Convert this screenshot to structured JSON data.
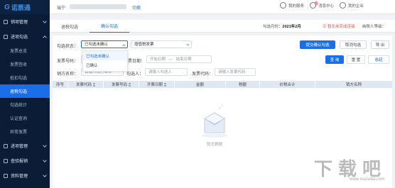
{
  "app": {
    "logo_mark": "G",
    "logo_text": "诺票通"
  },
  "sidebar": {
    "groups": [
      {
        "label": "销项管理"
      },
      {
        "label": "进项勾选"
      },
      {
        "label": "进项管理"
      },
      {
        "label": "查验报销"
      },
      {
        "label": "资料管理"
      }
    ],
    "items": [
      {
        "label": "发票总览"
      },
      {
        "label": "发票签收"
      },
      {
        "label": "抵扣勾选"
      },
      {
        "label": "退税勾选"
      },
      {
        "label": "勾选统计"
      },
      {
        "label": "认证查询"
      },
      {
        "label": "异常发票"
      }
    ]
  },
  "header": {
    "company_prefix": "瑞宁",
    "switch_label": "切换",
    "my_service": "我的服务",
    "messages": "消息中心",
    "messages_badge": "9",
    "my_company": "我的企业"
  },
  "tabs": {
    "items": [
      {
        "label": "退税勾选"
      },
      {
        "label": "确认勾选"
      }
    ],
    "period_label": "勾选月份：",
    "period_value": "2021年2月",
    "status_note": "⊘ 暂无未完成连接",
    "taxpayer_label": "纳税人等级："
  },
  "filters": {
    "status_label": "勾选状态：",
    "status_value": "已勾选未确认",
    "type_value": "增值税发票",
    "invoice_code_label": "发票号码：",
    "invoice_code_placeholder": "",
    "date_label": "开票日期：",
    "date_start_placeholder": "开始日期",
    "date_sep": "—",
    "date_end_placeholder": "结束日期",
    "seller_label": "销方名称：",
    "seller_placeholder": "请输入销方名称",
    "checker_label": "勾选人：",
    "checker_placeholder": "请输入勾选人",
    "invoice_code2_label": "发票代码：",
    "invoice_code2_placeholder": "请输入发票代码",
    "dropdown_options": [
      "已勾选未确认",
      "已确认"
    ]
  },
  "actions": {
    "submit": "提交确认勾选",
    "cancel": "取消勾选",
    "export": "导 出",
    "search": "查 询",
    "reset": "重 置",
    "collapse": "收起"
  },
  "table": {
    "columns": [
      "序号",
      "发票代码",
      "发票号码",
      "开票日期",
      "金额",
      "税额",
      "价税合计",
      "销方名称"
    ],
    "empty_text": "暂无数据"
  },
  "watermark": {
    "chars": [
      "下",
      "载",
      "吧"
    ],
    "url": "www.xiazaiba.com"
  }
}
